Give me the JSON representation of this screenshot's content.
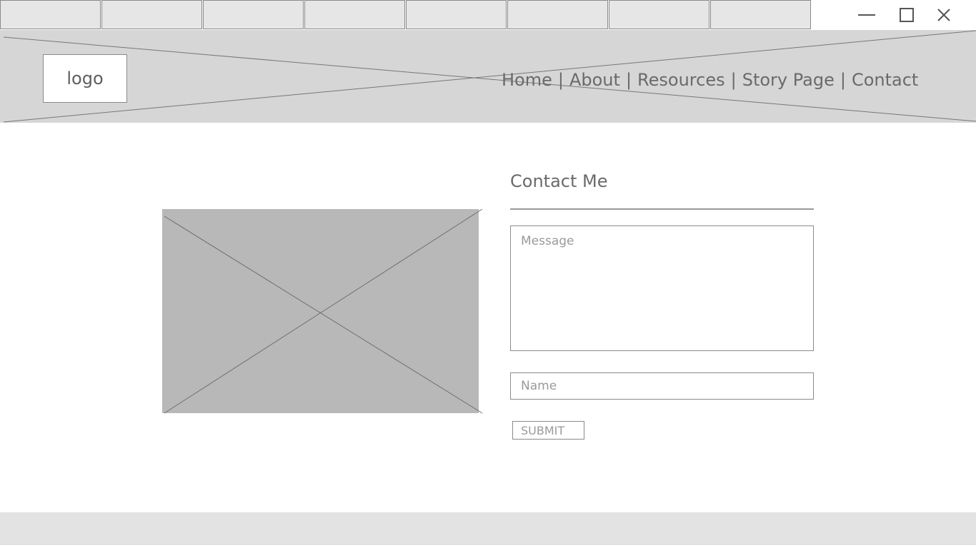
{
  "tabs": [
    "",
    "",
    "",
    "",
    "",
    "",
    "",
    ""
  ],
  "window_controls": {
    "minimize_icon": "minimize-icon",
    "maximize_icon": "maximize-icon",
    "close_icon": "close-icon"
  },
  "header": {
    "logo": "logo",
    "nav": [
      "Home",
      "About",
      "Resources",
      "Story Page",
      "Contact"
    ],
    "separator": "|"
  },
  "contact": {
    "title": "Contact Me",
    "message_placeholder": "Message",
    "name_placeholder": "Name",
    "submit_label": "SUBMIT"
  },
  "colors": {
    "header_bg": "#d6d6d6",
    "image_placeholder_bg": "#b8b8b8",
    "tab_bg": "#e6e6e6",
    "footer_bg": "#e3e3e3"
  }
}
